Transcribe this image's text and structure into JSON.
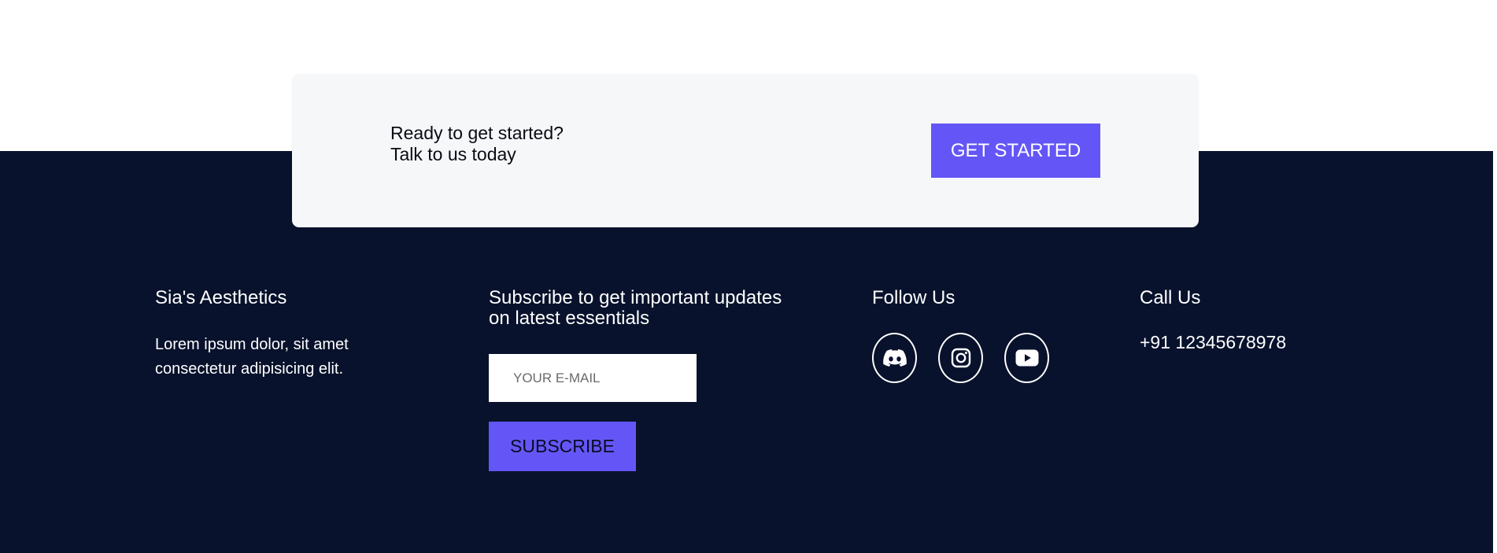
{
  "cta": {
    "line1": "Ready to get started?",
    "line2": "Talk to us today",
    "button_label": "GET STARTED"
  },
  "footer": {
    "brand": {
      "title": "Sia's Aesthetics",
      "description": "Lorem ipsum dolor, sit amet consectetur adipisicing elit."
    },
    "subscribe": {
      "heading_line1": "Subscribe to get important updates",
      "heading_line2": "on latest essentials",
      "email_placeholder": "YOUR E-MAIL",
      "button_label": "SUBSCRIBE"
    },
    "follow": {
      "heading": "Follow Us",
      "icons": [
        "discord-icon",
        "instagram-icon",
        "youtube-icon"
      ]
    },
    "call": {
      "heading": "Call Us",
      "phone": "+91 12345678978"
    }
  },
  "colors": {
    "footer_bg": "#08122c",
    "accent": "#6456f6",
    "card_bg": "#f6f7f9"
  }
}
